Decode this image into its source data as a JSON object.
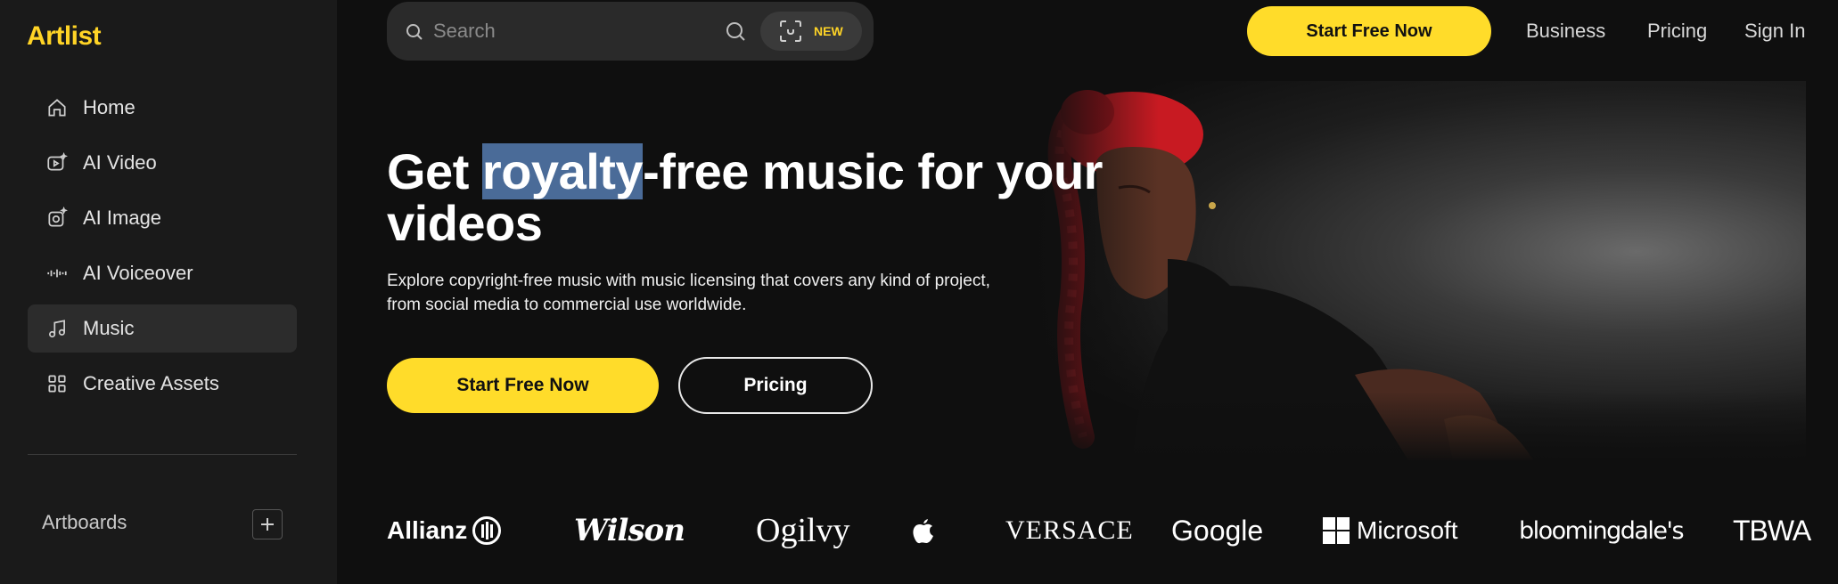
{
  "brand": {
    "logo": "Artlist",
    "accent": "#ffd426"
  },
  "sidebar": {
    "items": [
      {
        "label": "Home",
        "icon": "home-icon",
        "active": false
      },
      {
        "label": "AI Video",
        "icon": "ai-video-icon",
        "active": false
      },
      {
        "label": "AI Image",
        "icon": "ai-image-icon",
        "active": false
      },
      {
        "label": "AI Voiceover",
        "icon": "waveform-icon",
        "active": false
      },
      {
        "label": "Music",
        "icon": "music-note-icon",
        "active": true
      },
      {
        "label": "Creative Assets",
        "icon": "grid-icon",
        "active": false
      }
    ],
    "artboards_label": "Artboards"
  },
  "search": {
    "placeholder": "Search",
    "badge": "NEW"
  },
  "header": {
    "cta": "Start Free Now",
    "links": [
      "Business",
      "Pricing",
      "Sign In"
    ]
  },
  "hero": {
    "headline_before": "Get ",
    "headline_highlight": "royalty",
    "headline_after": "-free music for your videos",
    "subtitle_line1": "Explore copyright-free music with music licensing that covers any kind of project,",
    "subtitle_line2": "from social media to commercial use worldwide.",
    "primary_cta": "Start Free Now",
    "secondary_cta": "Pricing"
  },
  "logos": {
    "allianz": "Allianz",
    "wilson": "Wilson",
    "ogilvy": "Ogilvy",
    "apple": "apple-logo",
    "versace": "VERSACE",
    "google": "Google",
    "microsoft": "Microsoft",
    "bloomingdales": "bloomingdale's",
    "tbwa": "TBWA"
  }
}
